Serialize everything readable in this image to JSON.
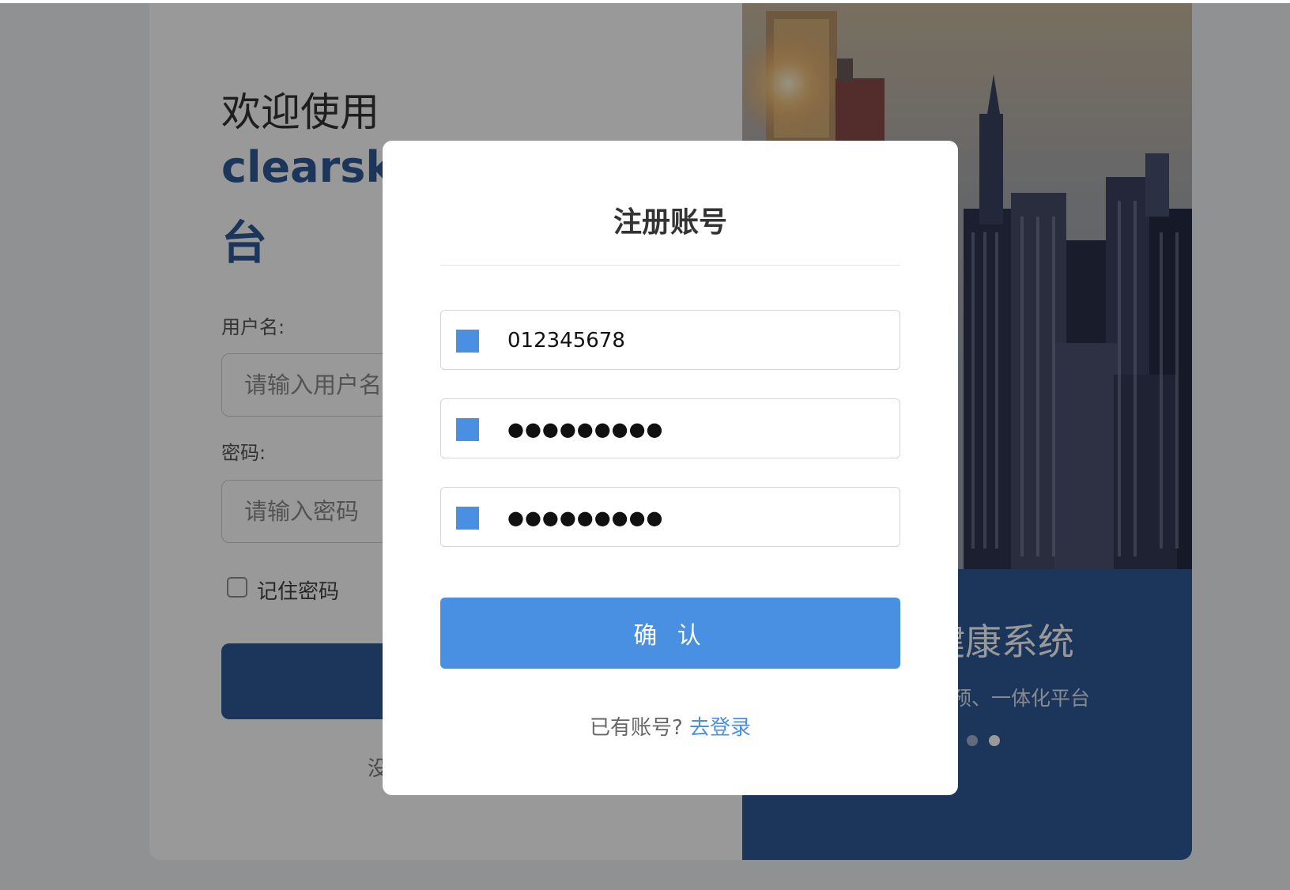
{
  "background_login": {
    "welcome_text": "欢迎使用",
    "brand_name": "clearsky",
    "brand_line2": "台",
    "username_label": "用户名:",
    "username_placeholder": "请输入用户名",
    "password_label": "密码:",
    "password_placeholder": "请输入密码",
    "remember_label": "记住密码",
    "no_account_text": "没"
  },
  "promo": {
    "title": "理健康系统",
    "subtitle": "警、干预、一体化平台",
    "slide_count": 3,
    "active_slide": 3
  },
  "register_modal": {
    "title": "注册账号",
    "fields": [
      {
        "type": "text",
        "value": "012345678"
      },
      {
        "type": "password",
        "value": "●●●●●●●●●"
      },
      {
        "type": "password",
        "value": "●●●●●●●●●"
      }
    ],
    "confirm_label": "确 认",
    "has_account_text": "已有账号?",
    "login_link_label": "去登录"
  },
  "colors": {
    "primary": "#4a90e2",
    "brand_dark": "#2d5b96",
    "overlay": "rgba(0,0,0,0.4)"
  }
}
